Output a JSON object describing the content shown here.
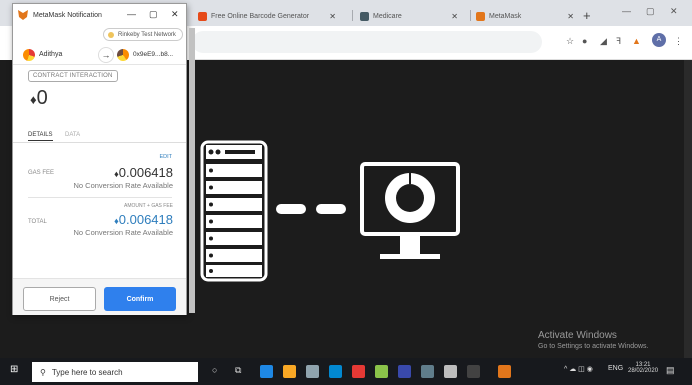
{
  "browser": {
    "tabs": [
      {
        "label": "MetaMask Notification",
        "favicon_color": "#e2761b"
      },
      {
        "label": "Free Online Barcode Generator",
        "favicon_color": "#e64a19"
      },
      {
        "label": "Medicare",
        "favicon_color": "#455a64"
      },
      {
        "label": "MetaMask",
        "favicon_color": "#e2761b"
      }
    ],
    "new_tab_icon": "plus-icon"
  },
  "metamask": {
    "window_title": "MetaMask Notification",
    "network": "Rinkeby Test Network",
    "from_account": "Adithya",
    "to_address": "0x9eE9...b8...",
    "interaction_type": "CONTRACT INTERACTION",
    "amount": "0",
    "tabs": {
      "details": "DETAILS",
      "data": "DATA"
    },
    "edit_label": "EDIT",
    "gas_fee_label": "GAS FEE",
    "gas_fee_value": "0.006418",
    "gas_fee_sub": "No Conversion Rate Available",
    "amount_gas_label": "AMOUNT + GAS FEE",
    "total_label": "TOTAL",
    "total_value": "0.006418",
    "total_sub": "No Conversion Rate Available",
    "reject_label": "Reject",
    "confirm_label": "Confirm"
  },
  "page": {
    "activate_title": "Activate Windows",
    "activate_sub": "Go to Settings to activate Windows."
  },
  "taskbar": {
    "search_placeholder": "Type here to search",
    "time": "13:21",
    "date": "28/02/2020",
    "lang": "ENG"
  },
  "colors": {
    "accent": "#2f80ed",
    "page_bg": "#1c1c1c",
    "total_blue": "#2f7ebd"
  }
}
